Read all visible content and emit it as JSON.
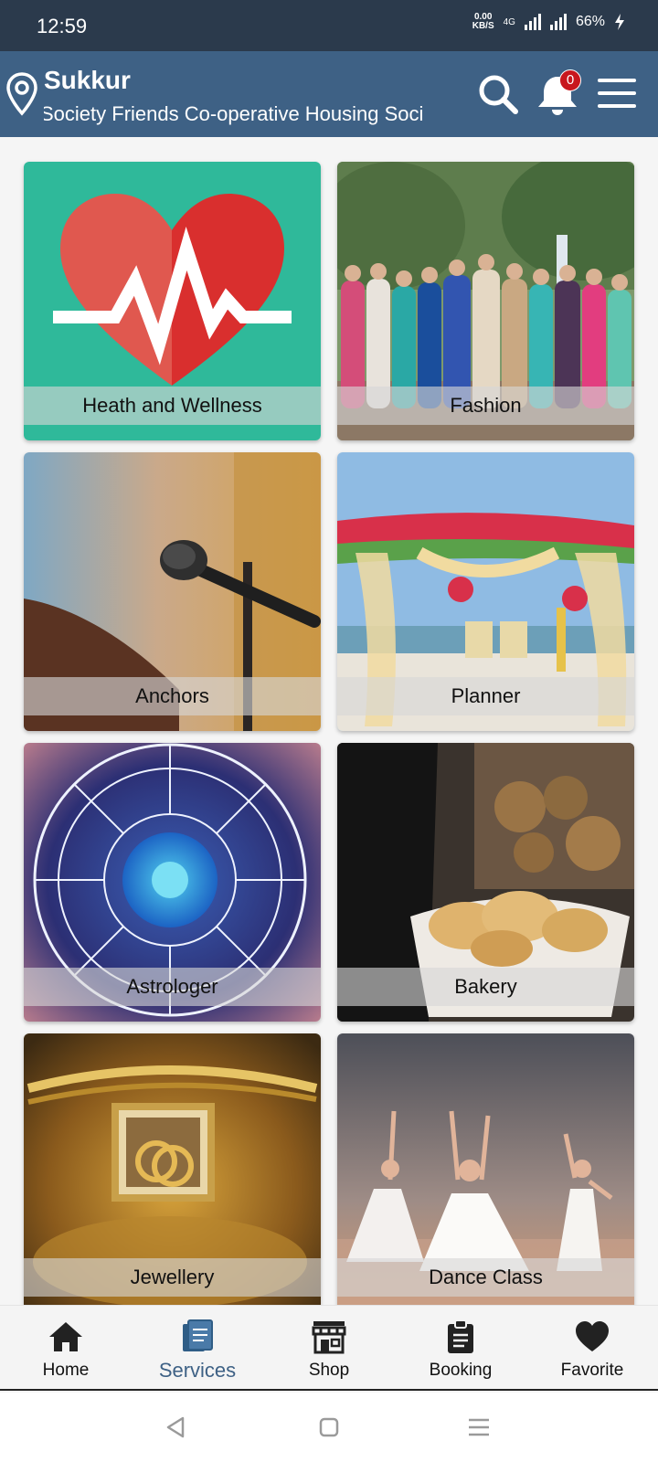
{
  "status_bar": {
    "time": "12:59",
    "net_speed_value": "0.00",
    "net_speed_unit": "KB/S",
    "network_type": "4G",
    "battery": "66%"
  },
  "header": {
    "city": "Sukkur",
    "society": "Society Friends Co-operative Housing Soci",
    "notification_count": "0",
    "colors": {
      "header_bg": "#3e6185",
      "status_bg": "#2b3a4c",
      "badge": "#c8161d"
    }
  },
  "categories": [
    {
      "label": "Heath and Wellness",
      "icon": "heart-pulse-icon"
    },
    {
      "label": "Fashion",
      "icon": "fashion-photo"
    },
    {
      "label": "Anchors",
      "icon": "microphone-photo"
    },
    {
      "label": "Planner",
      "icon": "wedding-stage-photo"
    },
    {
      "label": "Astrologer",
      "icon": "zodiac-wheel-photo"
    },
    {
      "label": "Bakery",
      "icon": "bread-basket-photo"
    },
    {
      "label": "Jewellery",
      "icon": "ring-box-photo"
    },
    {
      "label": "Dance Class",
      "icon": "dancers-photo"
    }
  ],
  "bottom_nav": {
    "items": [
      {
        "label": "Home",
        "icon": "home-icon"
      },
      {
        "label": "Services",
        "icon": "document-icon"
      },
      {
        "label": "Shop",
        "icon": "store-icon"
      },
      {
        "label": "Booking",
        "icon": "clipboard-icon"
      },
      {
        "label": "Favorite",
        "icon": "heart-icon"
      }
    ],
    "active": "Services"
  }
}
